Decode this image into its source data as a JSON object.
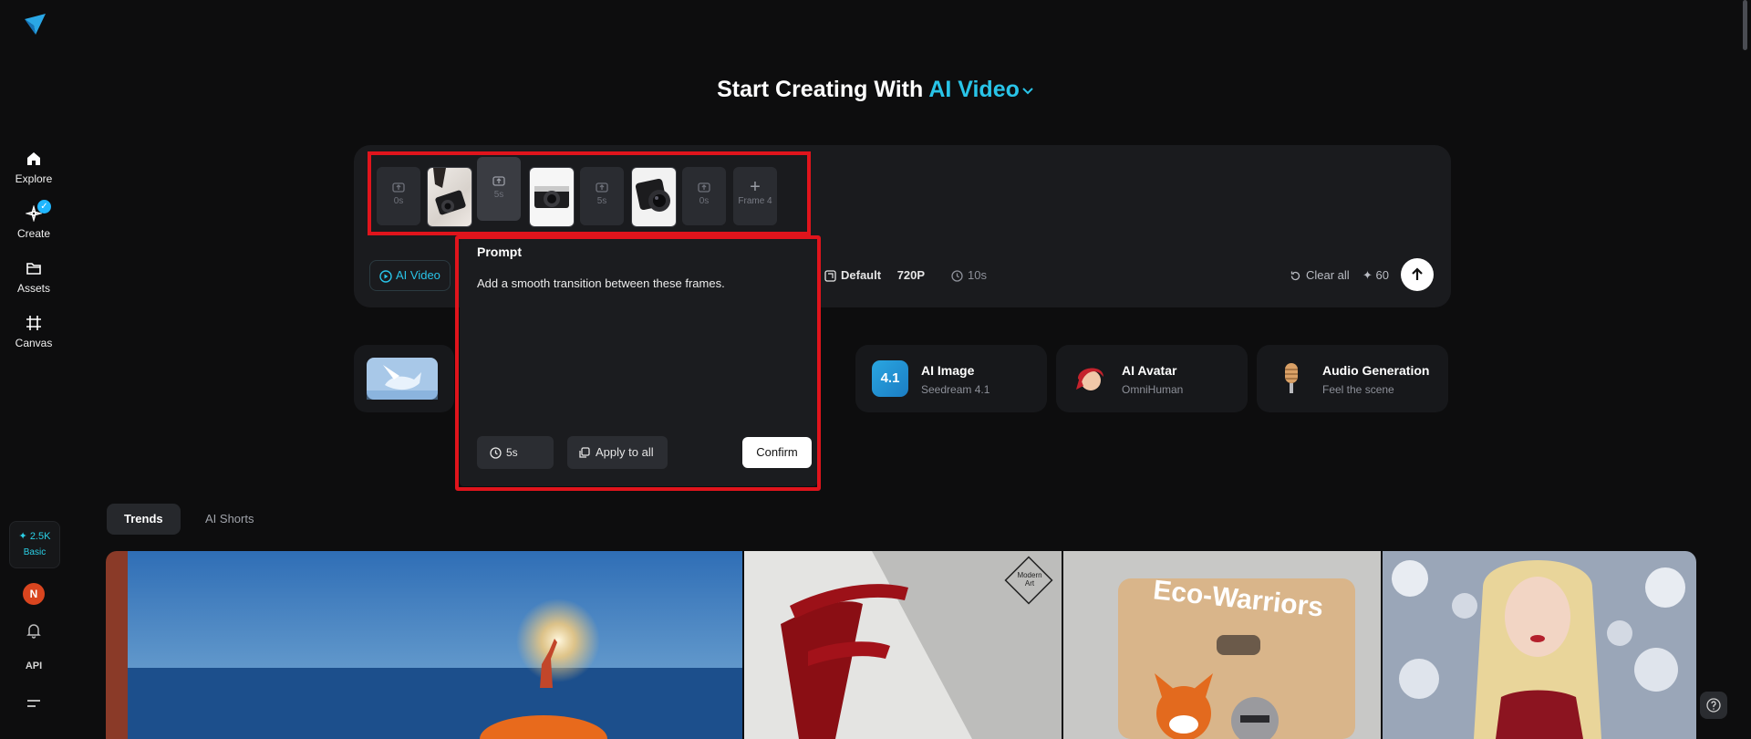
{
  "nav": {
    "items": [
      {
        "label": "Explore"
      },
      {
        "label": "Create"
      },
      {
        "label": "Assets"
      },
      {
        "label": "Canvas"
      }
    ],
    "credits": "2.5K",
    "plan": "Basic",
    "avatar_initial": "N",
    "api_label": "API"
  },
  "heading": {
    "prefix": "Start Creating With",
    "mode": "AI Video"
  },
  "frames": [
    {
      "kind": "duration",
      "label": "0s"
    },
    {
      "kind": "image",
      "subject": "black camera on white sheet"
    },
    {
      "kind": "duration",
      "label": "5s",
      "active": true
    },
    {
      "kind": "image",
      "subject": "vintage camera"
    },
    {
      "kind": "duration",
      "label": "5s"
    },
    {
      "kind": "image",
      "subject": "camera lens"
    },
    {
      "kind": "duration",
      "label": "0s"
    },
    {
      "kind": "add",
      "label": "Frame 4"
    }
  ],
  "toolbar": {
    "mode": "AI Video",
    "aspect": "Default",
    "resolution": "720P",
    "duration": "10s",
    "clear_all": "Clear all",
    "cost": "60"
  },
  "popup": {
    "title": "Prompt",
    "text": "Add a smooth transition between these frames.",
    "duration": "5s",
    "apply_all": "Apply to all",
    "confirm": "Confirm"
  },
  "cards": [
    {
      "title": "AI Image",
      "subtitle": "Seedream 4.1",
      "badge": "4.1"
    },
    {
      "title": "AI Avatar",
      "subtitle": "OmniHuman"
    },
    {
      "title": "Audio Generation",
      "subtitle": "Feel the scene"
    }
  ],
  "tabs": [
    "Trends",
    "AI Shorts"
  ],
  "gallery": [
    {
      "subject": "figure holding light over sea"
    },
    {
      "subject": "red brush letter E",
      "badge": "Modern Art"
    },
    {
      "subject": "Eco-Warriors toy package",
      "text": "Eco-Warriors"
    },
    {
      "subject": "woman with white roses"
    }
  ],
  "colors": {
    "accent": "#29c4e8",
    "highlight": "#e0141c",
    "background": "#0d0d0e"
  }
}
